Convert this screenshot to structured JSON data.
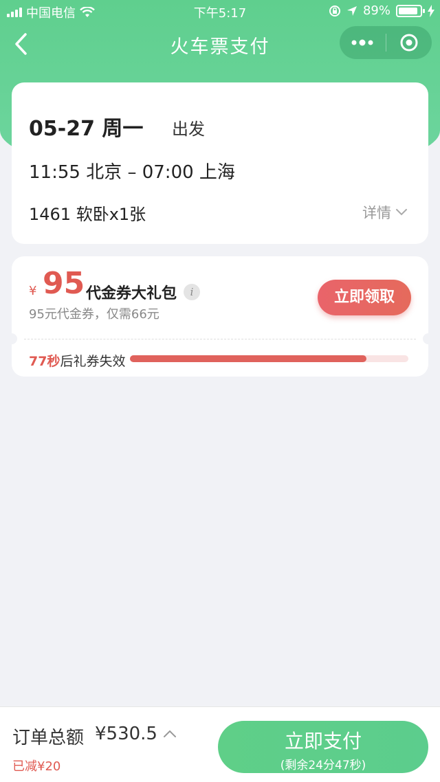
{
  "status_bar": {
    "carrier": "中国电信",
    "time": "下午5:17",
    "battery": "89%",
    "battery_level": 0.89
  },
  "nav": {
    "title": "火车票支付"
  },
  "trip": {
    "date": "05-27 周一",
    "depart_label": "出发",
    "route": "11:55 北京 – 07:00 上海",
    "train": "1461 软卧x1张",
    "detail_label": "详情"
  },
  "coupon": {
    "currency": "¥",
    "amount": "95",
    "name": "代金券大礼包",
    "info_icon_text": "i",
    "sub": "95元代金券，仅需66元",
    "button": "立即领取",
    "timer_seconds": "77秒",
    "timer_suffix": "后礼券失效",
    "progress": 0.85
  },
  "bottom": {
    "total_label": "订单总额",
    "total_amount": "¥530.5",
    "reduced": "已减¥20",
    "pay_label": "立即支付",
    "pay_remaining": "(剩余24分47秒)"
  },
  "colors": {
    "brand_green": "#5fcf8e",
    "accent_red": "#e05a52"
  },
  "icons": {
    "back": "chevron-left-icon",
    "menu": "more-dots-icon",
    "close": "target-circle-icon",
    "detail": "chevron-down-icon",
    "total": "chevron-up-icon"
  }
}
